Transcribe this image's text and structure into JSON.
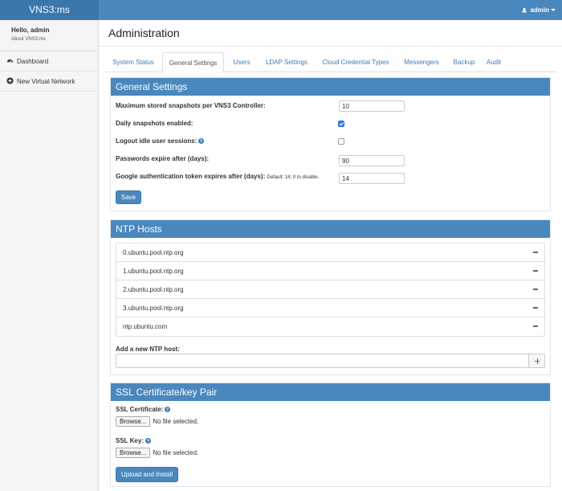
{
  "app": {
    "brand": "VNS3:ms",
    "user_menu": "admin"
  },
  "sidebar": {
    "hello": "Hello, admin",
    "about": "About VNS3:ms",
    "items": [
      {
        "label": "Dashboard",
        "icon": "dashboard-icon"
      },
      {
        "label": "New Virtual Network",
        "icon": "plus-circle-icon"
      }
    ]
  },
  "page": {
    "title": "Administration"
  },
  "tabs": [
    {
      "label": "System Status",
      "active": false
    },
    {
      "label": "General Settings",
      "active": true
    },
    {
      "label": "Users",
      "active": false
    },
    {
      "label": "LDAP Settings",
      "active": false
    },
    {
      "label": "Cloud Credential Types",
      "active": false
    },
    {
      "label": "Messengers",
      "active": false
    },
    {
      "label": "Backup",
      "active": false
    },
    {
      "label": "Audit",
      "active": false
    }
  ],
  "general_settings": {
    "title": "General Settings",
    "max_snapshots_label": "Maximum stored snapshots per VNS3 Controller:",
    "max_snapshots_value": "10",
    "daily_snapshots_label": "Daily snapshots enabled:",
    "daily_snapshots_checked": true,
    "logout_idle_label": "Logout idle user sessions:",
    "logout_idle_checked": false,
    "password_expire_label": "Passwords expire after (days):",
    "password_expire_value": "90",
    "google_token_label": "Google authentication token expires after (days):",
    "google_token_hint": "Default: 14; 0 to disable.",
    "google_token_value": "14",
    "save_label": "Save"
  },
  "ntp": {
    "title": "NTP Hosts",
    "hosts": [
      "0.ubuntu.pool.ntp.org",
      "1.ubuntu.pool.ntp.org",
      "2.ubuntu.pool.ntp.org",
      "3.ubuntu.pool.ntp.org",
      "ntp.ubuntu.com"
    ],
    "add_label": "Add a new NTP host:"
  },
  "ssl": {
    "title": "SSL Certificate/key Pair",
    "cert_label": "SSL Certificate:",
    "key_label": "SSL Key:",
    "browse_label": "Browse...",
    "no_file": "No file selected.",
    "upload_label": "Upload and Install"
  },
  "colors": {
    "accent": "#4a87bd",
    "brand_bg": "#3a77ad",
    "link": "#3a7bbf",
    "checkbox": "#3b7ddd"
  }
}
